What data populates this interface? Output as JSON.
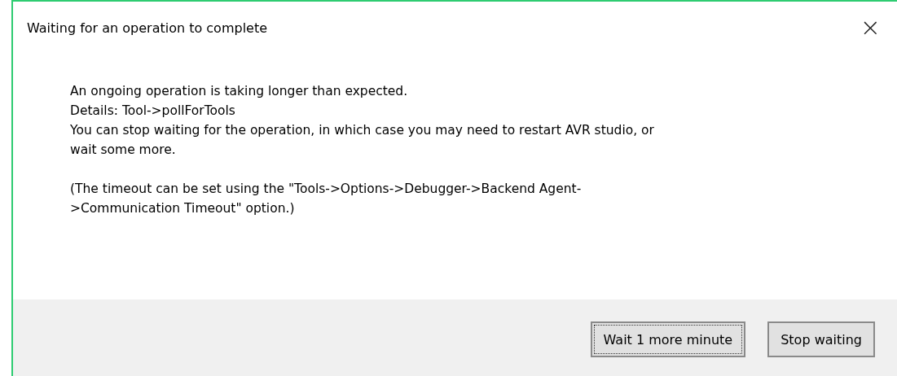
{
  "window": {
    "title": "Waiting for an operation to complete",
    "close": "×"
  },
  "message": {
    "paragraphs": [
      {
        "lines": [
          "An ongoing operation is taking longer than expected.",
          "Details: Tool->pollForTools",
          "You can stop waiting for the operation, in which case you may need to restart AVR studio, or",
          "wait some more."
        ]
      },
      {
        "lines": [
          "(The timeout can be set using the \"Tools->Options->Debugger->Backend Agent-",
          ">Communication Timeout\" option.)"
        ]
      }
    ]
  },
  "buttons": [
    {
      "label": "Wait 1 more minute",
      "focused": true
    },
    {
      "label": "Stop waiting",
      "focused": false
    }
  ]
}
